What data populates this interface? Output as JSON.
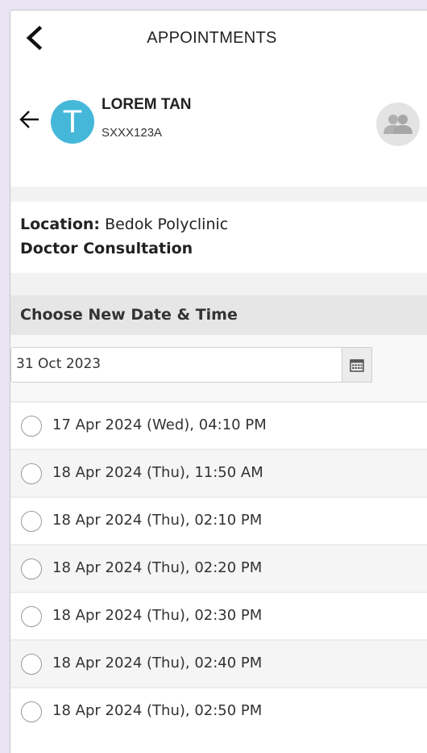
{
  "header": {
    "title": "APPOINTMENTS"
  },
  "patient": {
    "initial": "T",
    "name": "LOREM TAN",
    "id": "SXXX123A"
  },
  "appointment": {
    "location_label": "Location:",
    "location_value": "Bedok Polyclinic",
    "service": "Doctor Consultation"
  },
  "reschedule": {
    "section_title": "Choose New Date & Time",
    "date_value": "31 Oct 2023"
  },
  "slots": [
    "17 Apr 2024 (Wed), 04:10 PM",
    "18 Apr 2024 (Thu), 11:50 AM",
    "18 Apr 2024 (Thu), 02:10 PM",
    "18 Apr 2024 (Thu), 02:20 PM",
    "18 Apr 2024 (Thu), 02:30 PM",
    "18 Apr 2024 (Thu), 02:40 PM",
    "18 Apr 2024 (Thu), 02:50 PM"
  ],
  "colors": {
    "avatar": "#45b8da",
    "section_header": "#e6e6e6"
  },
  "icons": {
    "back": "chevron-left-icon",
    "patient_back": "arrow-left-icon",
    "family": "family-members-icon",
    "calendar": "calendar-icon"
  }
}
